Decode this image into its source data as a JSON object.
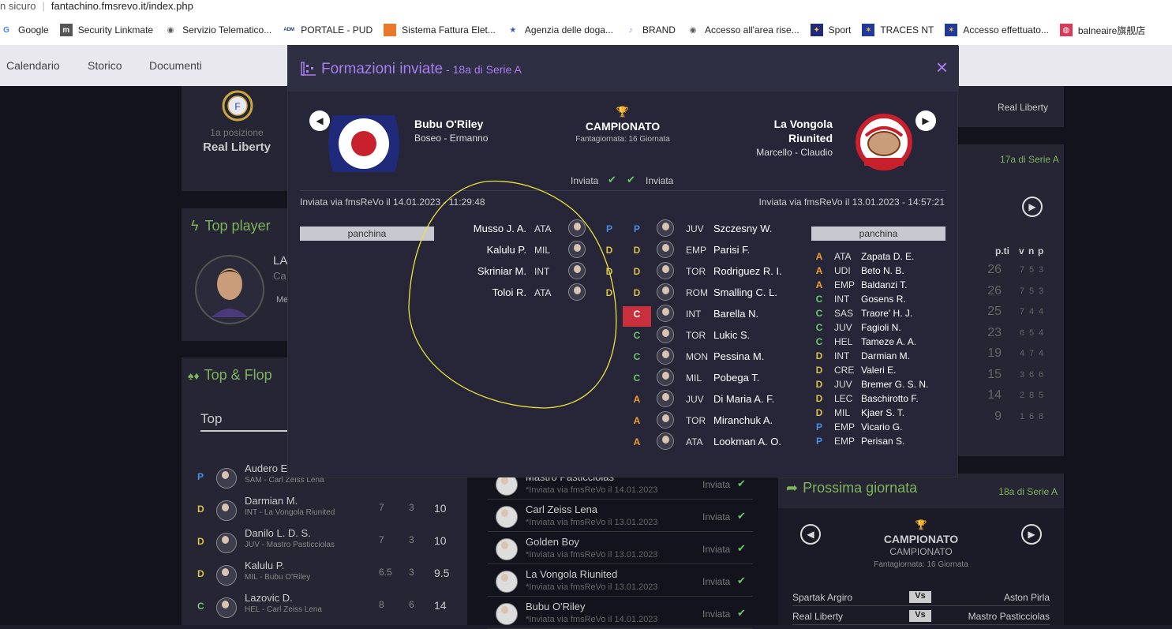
{
  "browser": {
    "security": "n sicuro",
    "url": "fantachino.fmsrevo.it/index.php",
    "bookmarks": [
      {
        "label": "Google",
        "icon": "google-icon"
      },
      {
        "label": "Security Linkmate",
        "icon": "linkmate-icon"
      },
      {
        "label": "Servizio Telematico...",
        "icon": "globe-icon"
      },
      {
        "label": "PORTALE - PUD",
        "icon": "adm-icon"
      },
      {
        "label": "Sistema Fattura Elet...",
        "icon": "orange-square-icon"
      },
      {
        "label": "Agenzia delle doga...",
        "icon": "star-icon"
      },
      {
        "label": "BRAND",
        "icon": "brand-icon"
      },
      {
        "label": "Accesso all'area rise...",
        "icon": "globe-icon"
      },
      {
        "label": "Sport",
        "icon": "sport-icon"
      },
      {
        "label": "TRACES NT",
        "icon": "eu-flag-icon"
      },
      {
        "label": "Accesso effettuato...",
        "icon": "eu-flag-icon"
      },
      {
        "label": "balneaire旗舰店",
        "icon": "shop-icon"
      }
    ]
  },
  "nav": {
    "items": [
      "Calendario",
      "Storico",
      "Documenti"
    ]
  },
  "background": {
    "position_label": "1a posizione",
    "leader": "Real Liberty",
    "top_player_title": "Top player",
    "top_player_name": "LA",
    "top_player_club": "Ca",
    "top_player_extra": "Me",
    "topflop_title": "Top & Flop",
    "topflop_tab": "Top",
    "top_list": [
      {
        "role": "P",
        "name": "Audero E.",
        "sub": "SAM - Carl Zeiss Lena",
        "a": "",
        "b": "",
        "c": ""
      },
      {
        "role": "D",
        "name": "Darmian M.",
        "sub": "INT - La Vongola Riunited",
        "a": "7",
        "b": "3",
        "c": "10"
      },
      {
        "role": "D",
        "name": "Danilo L. D. S.",
        "sub": "JUV - Mastro Pasticciolas",
        "a": "7",
        "b": "3",
        "c": "10"
      },
      {
        "role": "D",
        "name": "Kalulu P.",
        "sub": "MIL - Bubu O'Riley",
        "a": "6.5",
        "b": "3",
        "c": "9.5"
      },
      {
        "role": "C",
        "name": "Lazovic D.",
        "sub": "HEL - Carl Zeiss Lena",
        "a": "8",
        "b": "6",
        "c": "14"
      }
    ],
    "sent_list": [
      {
        "name": "Mastro Pasticciolas",
        "when": "*Inviata via fmsReVo il 14.01.2023",
        "status": "Inviata"
      },
      {
        "name": "Carl Zeiss Lena",
        "when": "*Inviata via fmsReVo il 13.01.2023",
        "status": "Inviata"
      },
      {
        "name": "Golden Boy",
        "when": "*Inviata via fmsReVo il 13.01.2023",
        "status": "Inviata"
      },
      {
        "name": "La Vongola Riunited",
        "when": "*Inviata via fmsReVo il 13.01.2023",
        "status": "Inviata"
      },
      {
        "name": "Bubu O'Riley",
        "when": "*Inviata via fmsReVo il 14.01.2023",
        "status": "Inviata"
      }
    ],
    "right_top_team": "Real Liberty",
    "standings_badge": "17a di Serie A",
    "standings_headers": [
      "p.ti",
      "v",
      "n",
      "p"
    ],
    "standings": [
      {
        "pts": "26",
        "v": "7",
        "n": "5",
        "p": "3"
      },
      {
        "pts": "26",
        "v": "7",
        "n": "5",
        "p": "3"
      },
      {
        "pts": "25",
        "v": "7",
        "n": "4",
        "p": "4"
      },
      {
        "pts": "23",
        "v": "6",
        "n": "5",
        "p": "4"
      },
      {
        "pts": "19",
        "v": "4",
        "n": "7",
        "p": "4"
      },
      {
        "pts": "15",
        "v": "3",
        "n": "6",
        "p": "6"
      },
      {
        "pts": "14",
        "v": "2",
        "n": "8",
        "p": "5"
      },
      {
        "pts": "9",
        "v": "1",
        "n": "6",
        "p": "8"
      }
    ],
    "next_title": "Prossima giornata",
    "next_badge": "18a di Serie A",
    "next_comp": "CAMPIONATO",
    "next_comp_sub": "CAMPIONATO",
    "next_fanta": "Fantagiornata: 16 Giornata",
    "next_matches": [
      {
        "home": "Spartak Argiro",
        "vs": "Vs",
        "away": "Aston Pirla"
      },
      {
        "home": "Real Liberty",
        "vs": "Vs",
        "away": "Mastro Pasticciolas"
      }
    ]
  },
  "modal": {
    "title": "Formazioni inviate",
    "subtitle": " - 18a di Serie A",
    "close": "×",
    "competition": "CAMPIONATO",
    "fantagiornata": "Fantagiornata: 16 Giornata",
    "home": {
      "name": "Bubu O'Riley",
      "owners": "Boseo - Ermanno",
      "status": "Inviata",
      "sent": "Inviata via fmsReVo il 14.01.2023 - 11:29:48",
      "bench_label": "panchina"
    },
    "away": {
      "name_line1": "La Vongola",
      "name_line2": "Riunited",
      "owners": "Marcello - Claudio",
      "status": "Inviata",
      "sent": "Inviata via fmsReVo il 13.01.2023 - 14:57:21",
      "bench_label": "panchina"
    },
    "home_lineup": [
      {
        "name": "Musso J. A.",
        "club": "ATA",
        "role": "P"
      },
      {
        "name": "Kalulu P.",
        "club": "MIL",
        "role": "D"
      },
      {
        "name": "Skriniar M.",
        "club": "INT",
        "role": "D"
      },
      {
        "name": "Toloi R.",
        "club": "ATA",
        "role": "D"
      }
    ],
    "away_lineup": [
      {
        "role": "P",
        "club": "JUV",
        "name": "Szczesny W."
      },
      {
        "role": "D",
        "club": "EMP",
        "name": "Parisi F."
      },
      {
        "role": "D",
        "club": "TOR",
        "name": "Rodriguez R. I."
      },
      {
        "role": "D",
        "club": "ROM",
        "name": "Smalling C. L."
      },
      {
        "role": "C",
        "club": "INT",
        "name": "Barella N."
      },
      {
        "role": "C",
        "club": "TOR",
        "name": "Lukic S."
      },
      {
        "role": "C",
        "club": "MON",
        "name": "Pessina M."
      },
      {
        "role": "C",
        "club": "MIL",
        "name": "Pobega T."
      },
      {
        "role": "A",
        "club": "JUV",
        "name": "Di Maria A. F."
      },
      {
        "role": "A",
        "club": "TOR",
        "name": "Miranchuk A."
      },
      {
        "role": "A",
        "club": "ATA",
        "name": "Lookman A. O."
      }
    ],
    "away_bench": [
      {
        "role": "A",
        "club": "ATA",
        "name": "Zapata D. E."
      },
      {
        "role": "A",
        "club": "UDI",
        "name": "Beto N. B."
      },
      {
        "role": "A",
        "club": "EMP",
        "name": "Baldanzi T."
      },
      {
        "role": "C",
        "club": "INT",
        "name": "Gosens R."
      },
      {
        "role": "C",
        "club": "SAS",
        "name": "Traore' H. J."
      },
      {
        "role": "C",
        "club": "JUV",
        "name": "Fagioli N."
      },
      {
        "role": "C",
        "club": "HEL",
        "name": "Tameze A. A."
      },
      {
        "role": "D",
        "club": "INT",
        "name": "Darmian M."
      },
      {
        "role": "D",
        "club": "CRE",
        "name": "Valeri E."
      },
      {
        "role": "D",
        "club": "JUV",
        "name": "Bremer G. S. N."
      },
      {
        "role": "D",
        "club": "LEC",
        "name": "Baschirotto F."
      },
      {
        "role": "D",
        "club": "MIL",
        "name": "Kjaer S. T."
      },
      {
        "role": "P",
        "club": "EMP",
        "name": "Vicario G."
      },
      {
        "role": "P",
        "club": "EMP",
        "name": "Perisan S."
      }
    ]
  }
}
